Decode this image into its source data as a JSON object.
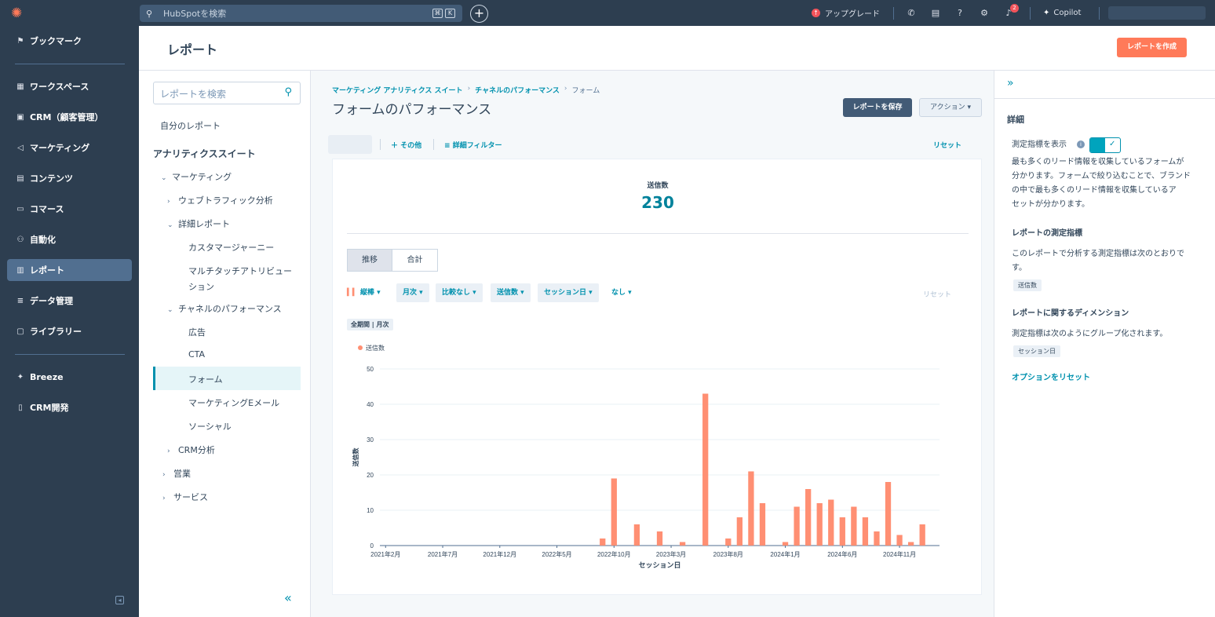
{
  "topbar": {
    "search_placeholder": "HubSpotを検索",
    "kbd1": "⌘",
    "kbd2": "K",
    "upgrade_label": "アップグレード",
    "notification_count": "2",
    "copilot_label": "Copilot"
  },
  "nav": {
    "bookmark": "ブックマーク",
    "items": [
      {
        "label": "ワークスペース",
        "icon": "grid-icon"
      },
      {
        "label": "CRM（顧客管理）",
        "icon": "contacts-icon"
      },
      {
        "label": "マーケティング",
        "icon": "megaphone-icon"
      },
      {
        "label": "コンテンツ",
        "icon": "content-icon"
      },
      {
        "label": "コマース",
        "icon": "commerce-icon"
      },
      {
        "label": "自動化",
        "icon": "automation-icon"
      },
      {
        "label": "レポート",
        "icon": "bar-chart-icon"
      },
      {
        "label": "データ管理",
        "icon": "database-icon"
      },
      {
        "label": "ライブラリー",
        "icon": "folder-icon"
      }
    ],
    "breeze": "Breeze",
    "crm_dev": "CRM開発"
  },
  "header": {
    "title": "レポート",
    "create_button": "レポートを作成"
  },
  "report_panel": {
    "search_placeholder": "レポートを検索",
    "my_reports": "自分のレポート",
    "suite_heading": "アナリティクススイート",
    "marketing": "マーケティング",
    "web_traffic": "ウェブトラフィック分析",
    "detail_reports": "詳細レポート",
    "customer_journey": "カスタマージャーニー",
    "multi_touch_1": "マルチタッチアトリビュー",
    "multi_touch_2": "ション",
    "channel_perf": "チャネルのパフォーマンス",
    "ads": "広告",
    "cta": "CTA",
    "forms": "フォーム",
    "marketing_email": "マーケティングEメール",
    "social": "ソーシャル",
    "crm_analysis": "CRM分析",
    "sales": "営業",
    "service": "サービス"
  },
  "main": {
    "breadcrumb": [
      "マーケティング アナリティクス スイート",
      "チャネルのパフォーマンス",
      "フォーム"
    ],
    "title": "フォームのパフォーマンス",
    "save_button": "レポートを保存",
    "action_button": "アクション",
    "filter_other": "その他",
    "filter_detail": "詳細フィルター",
    "filter_reset": "リセット",
    "kpi_label": "送信数",
    "kpi_value": "230",
    "tab_trend": "推移",
    "tab_total": "合計",
    "chip_bar": "縦棒",
    "chip_monthly": "月次",
    "chip_compare": "比較なし",
    "chip_metric": "送信数",
    "chip_session": "セッション日",
    "chip_none": "なし",
    "chip_reset": "リセット",
    "period_tag": "全期間 | 月次"
  },
  "chart_data": {
    "type": "bar",
    "legend": "送信数",
    "ylabel": "送信数",
    "xlabel": "セッション日",
    "ylim": [
      0,
      50
    ],
    "yticks": [
      0,
      10,
      20,
      30,
      40,
      50
    ],
    "xtick_labels": [
      "2021年2月",
      "2021年7月",
      "2021年12月",
      "2022年5月",
      "2022年10月",
      "2023年3月",
      "2023年8月",
      "2024年1月",
      "2024年6月",
      "2024年11月"
    ],
    "categories": [
      "2021-02",
      "2021-03",
      "2021-04",
      "2021-05",
      "2021-06",
      "2021-07",
      "2021-08",
      "2021-09",
      "2021-10",
      "2021-11",
      "2021-12",
      "2022-01",
      "2022-02",
      "2022-03",
      "2022-04",
      "2022-05",
      "2022-06",
      "2022-07",
      "2022-08",
      "2022-09",
      "2022-10",
      "2022-11",
      "2022-12",
      "2023-01",
      "2023-02",
      "2023-03",
      "2023-04",
      "2023-05",
      "2023-06",
      "2023-07",
      "2023-08",
      "2023-09",
      "2023-10",
      "2023-11",
      "2023-12",
      "2024-01",
      "2024-02",
      "2024-03",
      "2024-04",
      "2024-05",
      "2024-06",
      "2024-07",
      "2024-08",
      "2024-09",
      "2024-10",
      "2024-11",
      "2024-12",
      "2025-01",
      "2025-02"
    ],
    "values": [
      0,
      0,
      0,
      0,
      0,
      0,
      0,
      0,
      0,
      0,
      0,
      0,
      0,
      0,
      0,
      0,
      0,
      0,
      0,
      2,
      19,
      0,
      6,
      0,
      4,
      0,
      1,
      0,
      43,
      0,
      2,
      8,
      21,
      12,
      0,
      1,
      11,
      16,
      12,
      13,
      8,
      11,
      8,
      4,
      18,
      3,
      1,
      6,
      0
    ],
    "color": "#ff8f73"
  },
  "right_panel": {
    "details_heading": "詳細",
    "show_metric": "測定指標を表示",
    "desc_lines": [
      "最も多くのリード情報を収集しているフォームが",
      "分かります。フォームで絞り込むことで、ブランド",
      "の中で最も多くのリード情報を収集しているア",
      "セットが分かります。"
    ],
    "metrics_heading": "レポートの測定指標",
    "metrics_desc": [
      "このレポートで分析する測定指標は次のとおりで",
      "す。"
    ],
    "metric_tag": "送信数",
    "dimension_heading": "レポートに関するディメンション",
    "dimension_desc": "測定指標は次のようにグループ化されます。",
    "dimension_tag": "セッション日",
    "reset_options": "オプションをリセット"
  }
}
